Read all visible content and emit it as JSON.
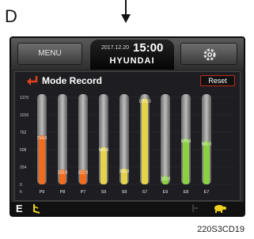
{
  "figure_label": "D",
  "caption": "220S3CD19",
  "header": {
    "menu_label": "MENU",
    "date": "2017.12.20",
    "time": "15:00",
    "brand": "HYUNDAI"
  },
  "panel": {
    "title": "Mode Record",
    "reset_label": "Reset"
  },
  "footer": {
    "mode": "E"
  },
  "colors": {
    "orange": "#f26b1d",
    "yellow": "#e3d24a",
    "green": "#8bd142",
    "accent_red": "#d9341f"
  },
  "chart_data": {
    "type": "bar",
    "ylabel": "",
    "xlabel": "",
    "y_unit": "h",
    "yticks": [
      1270,
      1016,
      762,
      508,
      254,
      0
    ],
    "ylim": [
      0,
      1270
    ],
    "categories": [
      "P9",
      "P8",
      "P7",
      "S9",
      "S8",
      "S7",
      "E9",
      "E8",
      "E7"
    ],
    "values": [
      714.0,
      215.0,
      212.0,
      542.0,
      231.0,
      1251.0,
      123.0,
      670.0,
      631.0
    ],
    "value_labels": [
      "714.0",
      "215.0",
      "212.0",
      "542.0",
      "231.0",
      "1251.0",
      "123.0",
      "670.0",
      "631.0"
    ],
    "bar_colors": [
      "orange",
      "orange",
      "orange",
      "yellow",
      "yellow",
      "yellow",
      "green",
      "green",
      "green"
    ]
  }
}
